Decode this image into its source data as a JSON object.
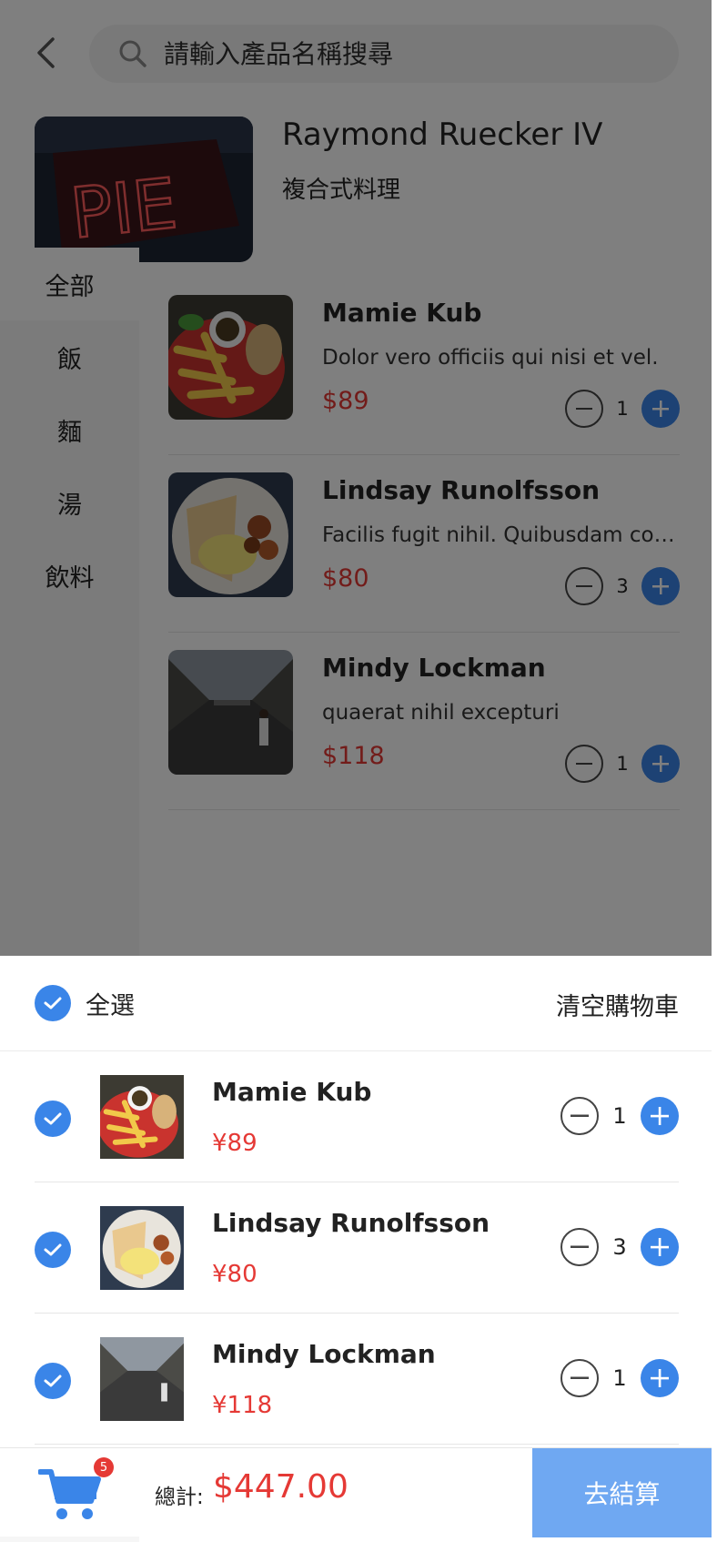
{
  "header": {
    "search_placeholder": "請輸入產品名稱搜尋"
  },
  "store": {
    "name": "Raymond Ruecker IV",
    "type": "複合式料理",
    "sign_text": "PIE"
  },
  "categories": [
    {
      "label": "全部",
      "active": true
    },
    {
      "label": "飯",
      "active": false
    },
    {
      "label": "麵",
      "active": false
    },
    {
      "label": "湯",
      "active": false
    },
    {
      "label": "飲料",
      "active": false
    }
  ],
  "products": [
    {
      "name": "Mamie Kub",
      "desc": "Dolor vero officiis qui nisi et vel.",
      "price": "$89",
      "qty": "1"
    },
    {
      "name": "Lindsay Runolfsson",
      "desc": "Facilis fugit nihil. Quibusdam corrupti.",
      "price": "$80",
      "qty": "3"
    },
    {
      "name": "Mindy Lockman",
      "desc": "quaerat nihil excepturi",
      "price": "$118",
      "qty": "1"
    }
  ],
  "cart": {
    "select_all_label": "全選",
    "clear_label": "清空購物車",
    "items": [
      {
        "name": "Mamie Kub",
        "price": "¥89",
        "qty": "1",
        "checked": true
      },
      {
        "name": "Lindsay Runolfsson",
        "price": "¥80",
        "qty": "3",
        "checked": true
      },
      {
        "name": "Mindy Lockman",
        "price": "¥118",
        "qty": "1",
        "checked": true
      }
    ]
  },
  "footer": {
    "badge_count": "5",
    "total_label": "總計:",
    "total_value": "$447.00",
    "checkout_label": "去結算"
  },
  "colors": {
    "accent": "#3a85e8",
    "price": "#e53935",
    "checkout_bg": "#6fa8f2"
  },
  "icons": {
    "back": "chevron-left-icon",
    "search": "search-icon",
    "check": "check-icon",
    "minus": "minus-icon",
    "plus": "plus-icon",
    "cart": "cart-icon"
  }
}
